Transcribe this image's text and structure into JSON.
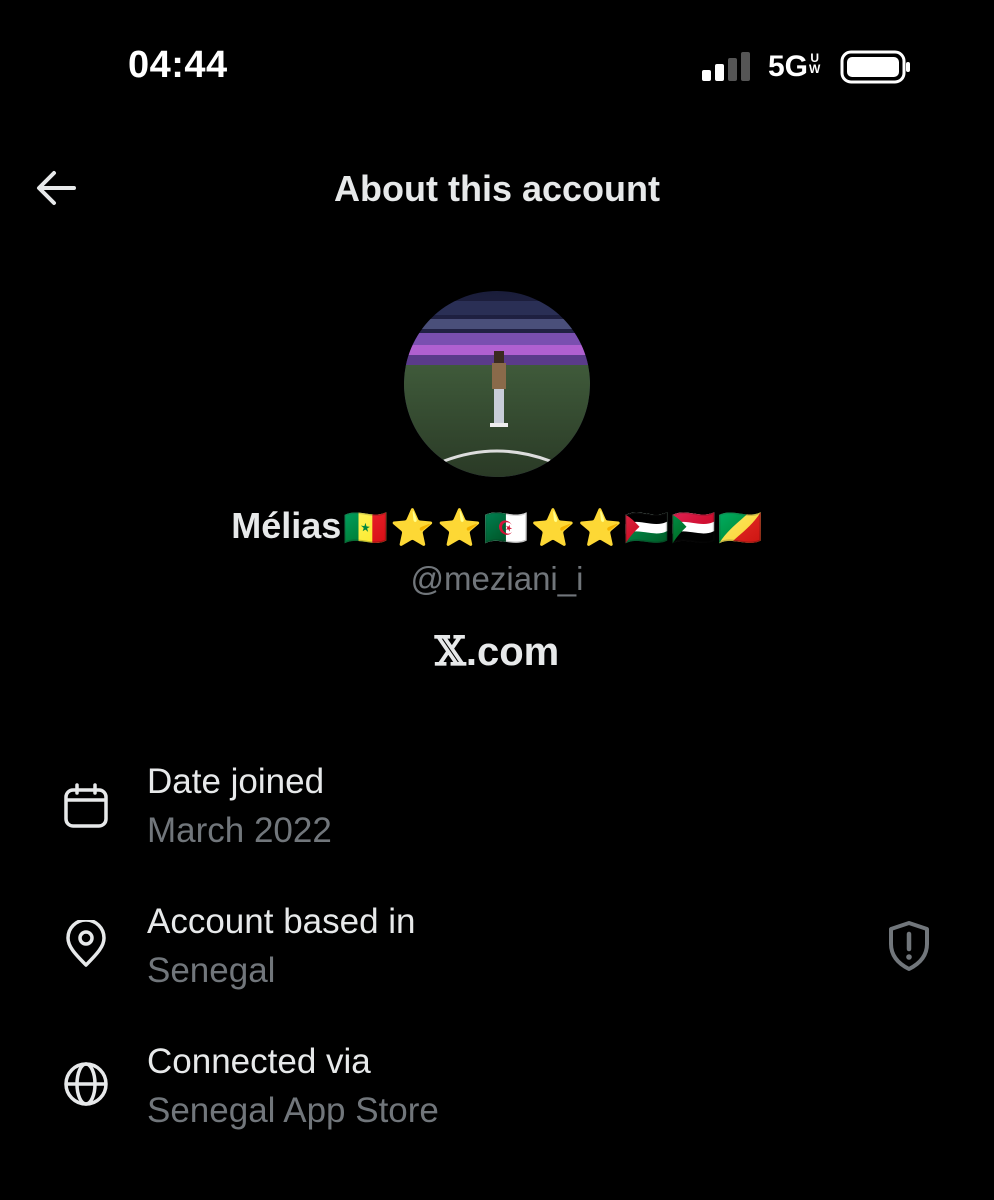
{
  "status_bar": {
    "time": "04:44",
    "network": "5G",
    "network_suffix_top": "U",
    "network_suffix_bottom": "W",
    "signal_icon": "cellular-signal-icon",
    "battery_icon": "battery-icon"
  },
  "header": {
    "title": "About this account",
    "back_icon": "arrow-left-icon"
  },
  "profile": {
    "display_name": "Mélias",
    "name_emojis": [
      "🇸🇳",
      "⭐",
      "⭐",
      "🇩🇿",
      "⭐",
      "⭐",
      "🇵🇸",
      "🇸🇩",
      "🇨🇬"
    ],
    "handle": "@meziani_i",
    "site_x": "𝕏",
    "site_suffix": ".com"
  },
  "details": [
    {
      "icon": "calendar-icon",
      "label": "Date joined",
      "value": "March 2022"
    },
    {
      "icon": "location-pin-icon",
      "label": "Account based in",
      "value": "Senegal",
      "action_icon": "shield-alert-icon"
    },
    {
      "icon": "globe-icon",
      "label": "Connected via",
      "value": "Senegal App Store"
    }
  ],
  "colors": {
    "background": "#000000",
    "primary_text": "#e7e9ea",
    "secondary_text": "#71767b"
  }
}
